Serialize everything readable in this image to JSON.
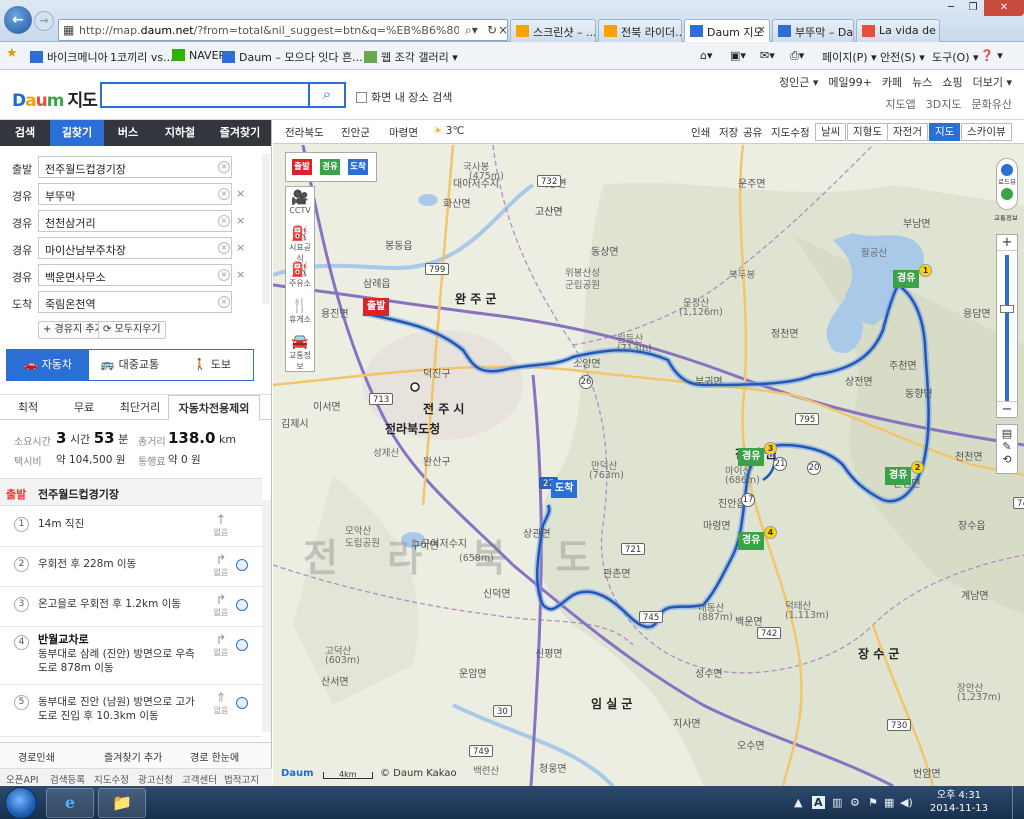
{
  "browser": {
    "url_prefix": "http://map.",
    "url_domain": "daum.net",
    "url_rest": "/?from=total&nil_suggest=btn&q=%EB%B6%80%EB%9A%9C%EB%",
    "tabs": [
      {
        "label": "스크린샷 – ...",
        "color": "#f5a300",
        "active": false
      },
      {
        "label": "전북 라이더...",
        "color": "#f5a300",
        "active": false
      },
      {
        "label": "Daum 지도",
        "color": "#2b6fd6",
        "active": true
      },
      {
        "label": "부뚜막 – Da...",
        "color": "#2b6fd6",
        "active": false
      },
      {
        "label": "La vida de V...",
        "color": "#e54f3c",
        "active": false
      }
    ],
    "favorites": [
      {
        "label": "바이크메니아",
        "icon": "daum-favicon"
      },
      {
        "label": "1코끼리 vs...",
        "icon": "none"
      },
      {
        "label": "NAVER",
        "icon": "naver-favicon"
      },
      {
        "label": "Daum – 모으다 잇다 흔...",
        "icon": "daum-favicon"
      },
      {
        "label": "웹 조각 갤러리 ▾",
        "icon": "web-slice-icon"
      }
    ],
    "commands": [
      "페이지(P) ▾",
      "안전(S) ▾",
      "도구(O) ▾",
      "❓ ▾"
    ]
  },
  "header": {
    "logo_parts": [
      "D",
      "a",
      "u",
      "m"
    ],
    "logo_suffix": "지도",
    "search_value": "",
    "in_screen_label": "화면 내 장소 검색",
    "top_links": [
      "정인근 ▾",
      "메일99+",
      "카페",
      "뉴스",
      "쇼핑",
      "더보기 ▾"
    ],
    "sub_links": [
      "지도앱",
      "3D지도",
      "문화유산"
    ]
  },
  "mode_tabs": [
    {
      "label": "검색",
      "active": false
    },
    {
      "label": "길찾기",
      "active": true
    },
    {
      "label": "버스",
      "active": false
    },
    {
      "label": "지하철",
      "active": false
    },
    {
      "label": "즐겨찾기",
      "active": false
    }
  ],
  "waypoints": [
    {
      "label": "출발",
      "value": "전주월드컵경기장",
      "removable": false
    },
    {
      "label": "경유",
      "value": "부뚜막",
      "removable": true
    },
    {
      "label": "경유",
      "value": "천천삼거리",
      "removable": true
    },
    {
      "label": "경유",
      "value": "마이산남부주차장",
      "removable": true
    },
    {
      "label": "경유",
      "value": "백운면사무소",
      "removable": true
    },
    {
      "label": "도착",
      "value": "죽림온천역",
      "removable": false
    }
  ],
  "waypoint_buttons": {
    "add": "+ 경유지 추가",
    "clear": "⟳ 모두지우기"
  },
  "transport": [
    {
      "label": "자동차",
      "icon": "car-icon",
      "glyph": "🚗",
      "active": true
    },
    {
      "label": "대중교통",
      "icon": "bus-icon",
      "glyph": "🚌",
      "active": false
    },
    {
      "label": "도보",
      "icon": "walk-icon",
      "glyph": "🚶",
      "active": false
    }
  ],
  "route_options": [
    {
      "label": "최적",
      "active": false
    },
    {
      "label": "무료",
      "active": false
    },
    {
      "label": "최단거리",
      "active": false
    },
    {
      "label": "자동차전용제외",
      "active": true
    }
  ],
  "summary": {
    "time_label": "소요시간",
    "time_h": "3",
    "time_h_unit": "시간",
    "time_m": "53",
    "time_m_unit": "분",
    "dist_label": "총거리",
    "dist_val": "138.0",
    "dist_unit": "km",
    "taxi_label": "택시비",
    "taxi_val": "약 104,500 원",
    "toll_label": "통행료",
    "toll_val": "약 0 원"
  },
  "start_row": {
    "tag": "출발",
    "name": "전주월드컵경기장"
  },
  "steps": [
    {
      "num": "1",
      "title": "",
      "text": "14m 직진",
      "dir": "↑",
      "dir_label": "없음"
    },
    {
      "num": "2",
      "title": "",
      "text": "우회전 후 228m 이동",
      "dir": "↱",
      "dir_label": "없음"
    },
    {
      "num": "3",
      "title": "",
      "text": "온고을로 우회전 후 1.2km 이동",
      "dir": "↱",
      "dir_label": "없음"
    },
    {
      "num": "4",
      "title": "반월교차로",
      "text": "동부대로 삼례 (진안) 방면으로 우측 도로 878m 이동",
      "dir": "↱",
      "dir_label": "없음"
    },
    {
      "num": "5",
      "title": "",
      "text": "동부대로 진안 (남원) 방면으로 고가 도로 진입 후 10.3km 이동",
      "dir": "⇑",
      "dir_label": "없음"
    }
  ],
  "bottom_actions": [
    "경로인쇄",
    "즐겨찾기 추가",
    "경로 한눈에"
  ],
  "footer_links": [
    "오픈API",
    "검색등록",
    "지도수정",
    "광고신청",
    "고객센터",
    "법적고지"
  ],
  "map": {
    "breadcrumbs": [
      "전라북도",
      "진안군",
      "마령면"
    ],
    "weather": "3℃",
    "toolbar_links": [
      "인쇄",
      "저장",
      "공유",
      "지도수정"
    ],
    "layer_buttons": [
      {
        "label": "날씨",
        "active": false
      },
      {
        "label": "지형도",
        "active": false
      },
      {
        "label": "자전거",
        "active": false
      }
    ],
    "type_buttons": [
      {
        "label": "지도",
        "active": true
      },
      {
        "label": "스카이뷰",
        "active": false
      }
    ],
    "legend": [
      "출발",
      "경유",
      "도착"
    ],
    "tools": [
      {
        "label": "CCTV",
        "glyph": "🎥"
      },
      {
        "label": "시표공식",
        "glyph": "⛽"
      },
      {
        "label": "주유소",
        "glyph": "⛽"
      },
      {
        "label": "휴게소",
        "glyph": "🍴"
      },
      {
        "label": "교통정보",
        "glyph": "🚘"
      }
    ],
    "zoom": {
      "road_view": "로드뷰",
      "traffic": "교통정보",
      "plus": "+",
      "minus": "−"
    },
    "scale": "4km",
    "copyright": "© Daum Kakao",
    "markers": [
      {
        "text": "출발",
        "kind": "red",
        "num": ""
      },
      {
        "text": "경유",
        "kind": "green",
        "num": "1"
      },
      {
        "text": "경유",
        "kind": "green",
        "num": "2"
      },
      {
        "text": "경유",
        "kind": "green",
        "num": "3"
      },
      {
        "text": "경유",
        "kind": "green",
        "num": "4"
      },
      {
        "text": "도착",
        "kind": "blue",
        "num": ""
      }
    ],
    "places": [
      "완 주 군",
      "전 주 시",
      "전라북도청",
      "덕진구",
      "완산구",
      "진 안 군",
      "장 수 군",
      "임 실 군",
      "삼례읍",
      "봉동읍",
      "고산면",
      "화산면",
      "동상면",
      "용진면",
      "소양면",
      "부귀면",
      "상전면",
      "정천면",
      "주천면",
      "안천면",
      "동향면",
      "부남면",
      "용담면",
      "진안읍",
      "마령면",
      "백운면",
      "성수면",
      "관촌면",
      "신덕면",
      "신평면",
      "운암면",
      "상관면",
      "구이면",
      "이서면",
      "김제시",
      "장수읍",
      "계남면",
      "천천면",
      "번암면",
      "산서면",
      "지사면",
      "오수면",
      "청웅면",
      "강진면",
      "덕치면",
      "임실읍",
      "운주면",
      "비봉면",
      "고산면",
      "대아저수지",
      "만덕산",
      "(763m)",
      "마이산",
      "(686m)",
      "내동산",
      "(887m)",
      "덕태산",
      "(1,113m)",
      "장안산",
      "(1,237m)",
      "운장산",
      "(1,126m)",
      "국사봉",
      "(475m)",
      "북두봉",
      "위봉산성",
      "군립공원",
      "원등산",
      "(713m)",
      "성제산",
      "모악산",
      "도립공원",
      "백련산",
      "(759m)",
      "팔공산",
      "고덕산",
      "(603m)",
      "전 라 북 도",
      "구이저수지",
      "(658m)"
    ],
    "roads": [
      "732",
      "799",
      "713",
      "27",
      "26",
      "21",
      "20",
      "17",
      "795",
      "743",
      "721",
      "745",
      "742",
      "749",
      "730",
      "30"
    ]
  },
  "taskbar": {
    "apps": [
      {
        "icon": "ie-icon",
        "glyph": "e"
      },
      {
        "icon": "folder-icon",
        "glyph": "📁"
      }
    ],
    "tray_lang": "A",
    "time": "오후 4:31",
    "date": "2014-11-13"
  }
}
